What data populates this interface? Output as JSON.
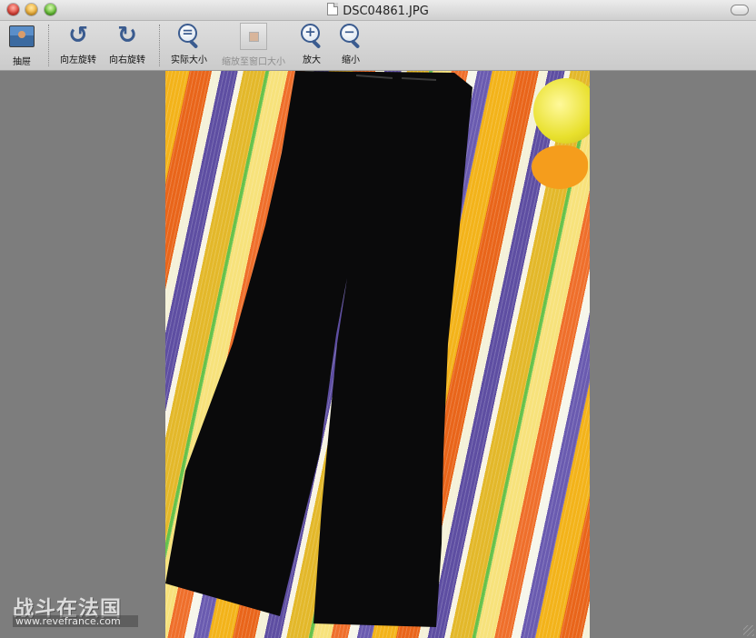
{
  "window": {
    "title": "DSC04861.JPG"
  },
  "toolbar": {
    "items": [
      {
        "label": "抽屉",
        "icon": "drawer-icon",
        "enabled": true
      },
      {
        "label": "向左旋转",
        "icon": "rotate-left-icon",
        "enabled": true
      },
      {
        "label": "向右旋转",
        "icon": "rotate-right-icon",
        "enabled": true
      },
      {
        "label": "实际大小",
        "icon": "actual-size-icon",
        "enabled": true
      },
      {
        "label": "缩放至窗口大小",
        "icon": "zoom-to-fit-icon",
        "enabled": false
      },
      {
        "label": "放大",
        "icon": "zoom-in-icon",
        "enabled": true
      },
      {
        "label": "缩小",
        "icon": "zoom-out-icon",
        "enabled": true
      }
    ]
  },
  "watermark": {
    "text": "战斗在法国",
    "url": "www.revefrance.com"
  },
  "colors": {
    "background": "#7d7d7d",
    "toolbar": "#d4d4d4",
    "accent": "#3a5b8f"
  }
}
